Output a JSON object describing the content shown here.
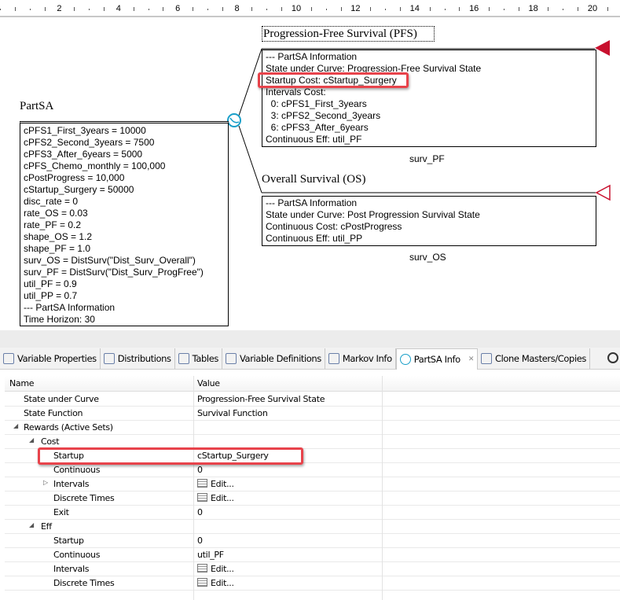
{
  "ruler": {
    "labels": [
      "2",
      "4",
      "6",
      "8",
      "10",
      "12",
      "14",
      "16",
      "18",
      "20"
    ]
  },
  "diagram": {
    "root_title": "PartSA",
    "root_lines": [
      "cPFS1_First_3years = 10000",
      "cPFS2_Second_3years = 7500",
      "cPFS3_After_6years = 5000",
      "cPFS_Chemo_monthly = 100,000",
      "cPostProgress = 10,000",
      "cStartup_Surgery = 50000",
      "disc_rate = 0",
      "rate_OS = 0.03",
      "rate_PF = 0.2",
      "shape_OS = 1.2",
      "shape_PF = 1.0",
      "surv_OS = DistSurv(\"Dist_Surv_Overall\")",
      "surv_PF = DistSurv(\"Dist_Surv_ProgFree\")",
      "util_PF = 0.9",
      "util_PP = 0.7",
      "--- PartSA Information",
      "Time Horizon: 30"
    ],
    "pfs": {
      "title": "Progression-Free Survival (PFS)",
      "lines": [
        "--- PartSA Information",
        "State under Curve: Progression-Free Survival State",
        "Startup Cost: cStartup_Surgery",
        "Intervals Cost:",
        "  0: cPFS1_First_3years",
        "  3: cPFS2_Second_3years",
        "  6: cPFS3_After_6years",
        "Continuous Eff: util_PF"
      ],
      "caption": "surv_PF"
    },
    "os": {
      "title": "Overall Survival (OS)",
      "lines": [
        "--- PartSA Information",
        "State under Curve: Post Progression Survival State",
        "Continuous Cost: cPostProgress",
        "Continuous Eff: util_PP"
      ],
      "caption": "surv_OS"
    }
  },
  "tabs": [
    {
      "label": "Variable Properties",
      "icon": "variable-properties-icon"
    },
    {
      "label": "Distributions",
      "icon": "distributions-icon"
    },
    {
      "label": "Tables",
      "icon": "tables-icon"
    },
    {
      "label": "Variable Definitions",
      "icon": "variable-definitions-icon"
    },
    {
      "label": "Markov Info",
      "icon": "markov-info-icon"
    },
    {
      "label": "PartSA Info",
      "icon": "partsa-info-icon",
      "active": true
    },
    {
      "label": "Clone Masters/Copies",
      "icon": "clone-masters-icon"
    }
  ],
  "table": {
    "headers": [
      "Name",
      "Value"
    ],
    "rows": [
      {
        "name": "State under Curve",
        "value": "Progression-Free Survival State",
        "level": 0
      },
      {
        "name": "State Function",
        "value": "Survival Function",
        "level": 0
      },
      {
        "name": "Rewards (Active Sets)",
        "value": "",
        "level": 0,
        "expander": "open"
      },
      {
        "name": "Cost",
        "value": "",
        "level": 1,
        "expander": "open"
      },
      {
        "name": "Startup",
        "value": "cStartup_Surgery",
        "level": 2
      },
      {
        "name": "Continuous",
        "value": "0",
        "level": 2
      },
      {
        "name": "Intervals",
        "value": "Edit...",
        "level": 2,
        "expander": "closed",
        "edit": true
      },
      {
        "name": "Discrete Times",
        "value": "Edit...",
        "level": 2,
        "edit": true
      },
      {
        "name": "Exit",
        "value": "0",
        "level": 2
      },
      {
        "name": "Eff",
        "value": "",
        "level": 1,
        "expander": "open"
      },
      {
        "name": "Startup",
        "value": "0",
        "level": 2
      },
      {
        "name": "Continuous",
        "value": "util_PF",
        "level": 2
      },
      {
        "name": "Intervals",
        "value": "Edit...",
        "level": 2,
        "edit": true
      },
      {
        "name": "Discrete Times",
        "value": "Edit...",
        "level": 2,
        "edit": true
      }
    ]
  },
  "colors": {
    "highlight": "#e8434b",
    "terminal": "#c8102e",
    "chance": "#1a9fc9"
  }
}
